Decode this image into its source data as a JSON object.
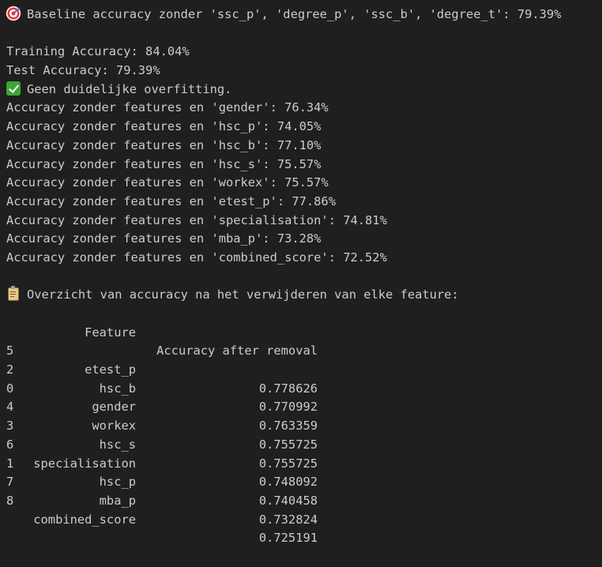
{
  "baseline": {
    "text": "Baseline accuracy zonder 'ssc_p', 'degree_p', 'ssc_b', 'degree_t': 79.39%"
  },
  "summary": {
    "training": "Training Accuracy: 84.04%",
    "test": "Test Accuracy: 79.39%",
    "overfit": "Geen duidelijke overfitting."
  },
  "removals": [
    "Accuracy zonder features en 'gender': 76.34%",
    "Accuracy zonder features en 'hsc_p': 74.05%",
    "Accuracy zonder features en 'hsc_b': 77.10%",
    "Accuracy zonder features en 'hsc_s': 75.57%",
    "Accuracy zonder features en 'workex': 75.57%",
    "Accuracy zonder features en 'etest_p': 77.86%",
    "Accuracy zonder features en 'specialisation': 74.81%",
    "Accuracy zonder features en 'mba_p': 73.28%",
    "Accuracy zonder features en 'combined_score': 72.52%"
  ],
  "overview": {
    "title": "Overzicht van accuracy na het verwijderen van elke feature:",
    "headers": [
      "Feature",
      "Accuracy after removal"
    ],
    "rows": [
      {
        "index": "5",
        "feature": "etest_p",
        "accuracy": "0.778626"
      },
      {
        "index": "2",
        "feature": "hsc_b",
        "accuracy": "0.770992"
      },
      {
        "index": "0",
        "feature": "gender",
        "accuracy": "0.763359"
      },
      {
        "index": "4",
        "feature": "workex",
        "accuracy": "0.755725"
      },
      {
        "index": "3",
        "feature": "hsc_s",
        "accuracy": "0.755725"
      },
      {
        "index": "6",
        "feature": "specialisation",
        "accuracy": "0.748092"
      },
      {
        "index": "1",
        "feature": "hsc_p",
        "accuracy": "0.740458"
      },
      {
        "index": "7",
        "feature": "mba_p",
        "accuracy": "0.732824"
      },
      {
        "index": "8",
        "feature": "combined_score",
        "accuracy": "0.725191"
      }
    ]
  },
  "icons": {
    "baseline": "target-icon",
    "overfit": "check-icon",
    "overview": "clipboard-icon"
  }
}
